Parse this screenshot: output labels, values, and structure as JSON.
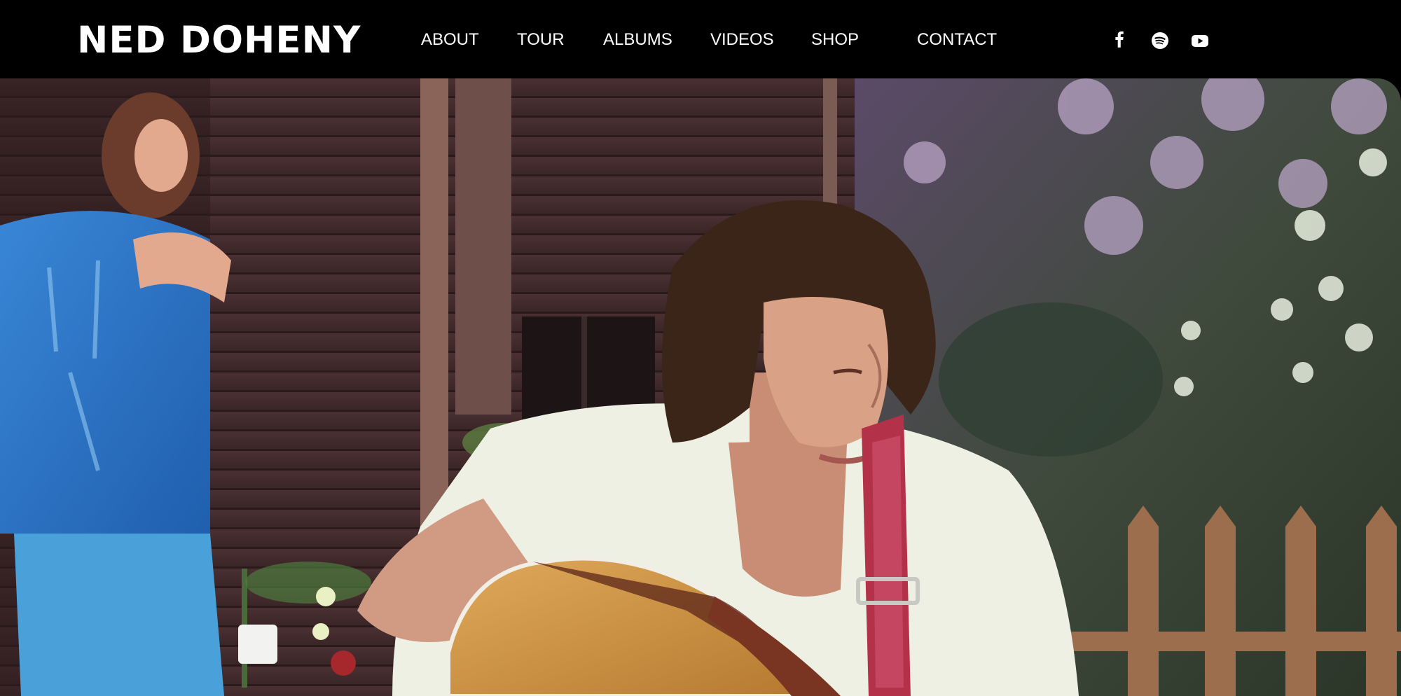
{
  "site": {
    "logo": "NED DOHENY"
  },
  "nav": {
    "items": [
      {
        "label": "ABOUT"
      },
      {
        "label": "TOUR"
      },
      {
        "label": "ALBUMS"
      },
      {
        "label": "VIDEOS"
      },
      {
        "label": "SHOP"
      },
      {
        "label": "CONTACT"
      }
    ]
  },
  "social": [
    {
      "icon": "facebook-icon"
    },
    {
      "icon": "spotify-icon"
    },
    {
      "icon": "youtube-icon"
    }
  ],
  "hero": {
    "image": "photo of a young man with shoulder-length hair playing an acoustic guitar outdoors, a woman in a blue outfit clapping in the background"
  },
  "colors": {
    "background": "#000000",
    "text": "#ffffff"
  }
}
